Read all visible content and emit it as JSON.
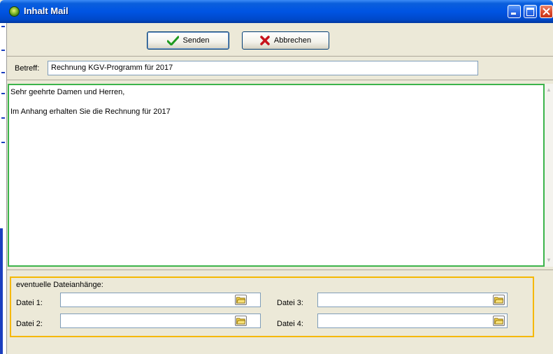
{
  "window": {
    "title": "Inhalt Mail"
  },
  "toolbar": {
    "send_label": "Senden",
    "cancel_label": "Abbrechen"
  },
  "subject": {
    "label": "Betreff:",
    "value": "Rechnung KGV-Programm für 2017"
  },
  "body": {
    "line1": "Sehr geehrte Damen und Herren,",
    "line2": "Im Anhang erhalten Sie die Rechnung für 2017"
  },
  "attachments": {
    "title": "eventuelle Dateianhänge:",
    "file1_label": "Datei 1:",
    "file2_label": "Datei 2:",
    "file3_label": "Datei 3:",
    "file4_label": "Datei 4:"
  },
  "colors": {
    "titlebar": "#0054e3",
    "body_border": "#3cb44b",
    "attachments_border": "#f5b800"
  }
}
